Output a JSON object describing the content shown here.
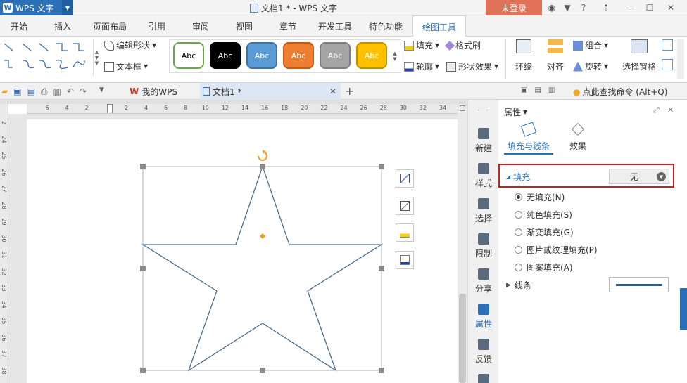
{
  "titlebar": {
    "app_name": "WPS 文字",
    "doc_title": "文档1 * - WPS 文字",
    "login_label": "未登录",
    "help_label": "?"
  },
  "ribbon_tabs": [
    "开始",
    "插入",
    "页面布局",
    "引用",
    "审阅",
    "视图",
    "章节",
    "开发工具",
    "特色功能",
    "绘图工具"
  ],
  "active_tab_index": 9,
  "ribbon": {
    "edit_shape": "编辑形状",
    "text_box": "文本框",
    "style_samples": [
      {
        "label": "Abc",
        "bg": "#ffffff",
        "fg": "#000000",
        "border": "#6aa84f"
      },
      {
        "label": "Abc",
        "bg": "#000000",
        "fg": "#ffffff",
        "border": "#000000"
      },
      {
        "label": "Abc",
        "bg": "#5b9bd5",
        "fg": "#ffffff",
        "border": "#41719c"
      },
      {
        "label": "Abc",
        "bg": "#ed7d31",
        "fg": "#ffffff",
        "border": "#c55a11"
      },
      {
        "label": "Abc",
        "bg": "#a5a5a5",
        "fg": "#ffffff",
        "border": "#7f7f7f"
      },
      {
        "label": "Abc",
        "bg": "#ffc000",
        "fg": "#ffffff",
        "border": "#bf9000"
      }
    ],
    "fill": "填充",
    "format_brush": "格式刷",
    "outline": "轮廓",
    "shape_effect": "形状效果",
    "wrap": "环绕",
    "align": "对齐",
    "group": "组合",
    "rotate": "旋转",
    "selection_pane": "选择窗格"
  },
  "tabbar": {
    "my_wps": "我的WPS",
    "doc_tab": "文档1 *",
    "search_cmd": "点此查找命令 (Alt+Q)"
  },
  "ruler_h_ticks": [
    "6",
    "4",
    "2",
    "",
    "2",
    "4",
    "6",
    "8",
    "10",
    "12",
    "14",
    "16",
    "18",
    "20",
    "22",
    "24",
    "26",
    "28",
    "30",
    "32",
    "34"
  ],
  "ruler_v_ticks": [
    "2",
    "24",
    "25",
    "26",
    "27",
    "28",
    "29",
    "30",
    "31",
    "32",
    "33",
    "34",
    "35",
    "36",
    "37",
    "38",
    "39"
  ],
  "side_strip": [
    "新建",
    "样式",
    "选择",
    "限制",
    "分享",
    "属性",
    "反馈"
  ],
  "panel": {
    "title": "属性",
    "tab_fill_line": "填充与线条",
    "tab_effect": "效果",
    "fill_section": "填充",
    "fill_value": "无",
    "options": [
      "无填充(N)",
      "纯色填充(S)",
      "渐变填充(G)",
      "图片或纹理填充(P)",
      "图案填充(A)"
    ],
    "selected_option_index": 0,
    "line_section": "线条",
    "line_color": "#2f5f8f"
  },
  "colors": {
    "accent": "#2b6fb6",
    "login_bg": "#e0725a",
    "highlight_border": "#cc1f1f",
    "star_stroke": "#4a6f92",
    "handle": "#8c8c8c",
    "rotate_handle": "#f0a020"
  }
}
